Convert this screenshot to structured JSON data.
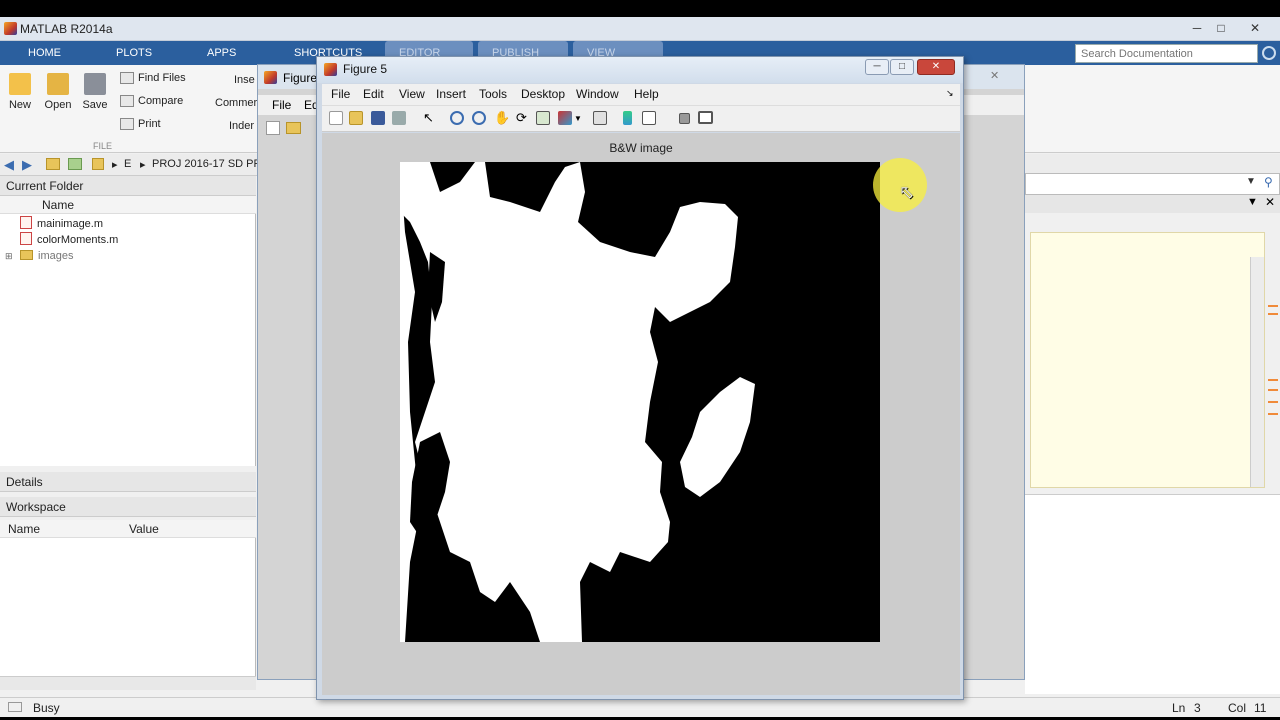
{
  "app": {
    "title": "MATLAB R2014a"
  },
  "tabs": [
    {
      "label": "HOME"
    },
    {
      "label": "PLOTS"
    },
    {
      "label": "APPS"
    },
    {
      "label": "SHORTCUTS"
    },
    {
      "label": "EDITOR"
    },
    {
      "label": "PUBLISH"
    },
    {
      "label": "VIEW"
    }
  ],
  "search": {
    "placeholder": "Search Documentation"
  },
  "ribbon": {
    "new": "New",
    "open": "Open",
    "save": "Save",
    "find_files": "Find Files",
    "compare": "Compare",
    "print": "Print",
    "insert": "Inse",
    "comment": "Commer",
    "indent": "Inder",
    "group_file": "FILE"
  },
  "address": {
    "crumb1": "E",
    "crumb2": "PROJ 2016-17 SD PRO"
  },
  "current_folder": {
    "title": "Current Folder",
    "col_name": "Name",
    "files": [
      "mainimage.m",
      "colorMoments.m"
    ],
    "folders": [
      "images"
    ]
  },
  "details": {
    "title": "Details"
  },
  "workspace": {
    "title": "Workspace",
    "col_name": "Name",
    "col_value": "Value"
  },
  "back_figure": {
    "title": "Figure",
    "menu_file": "File",
    "menu_edit": "Ed"
  },
  "figure5": {
    "title": "Figure 5",
    "menus": [
      "File",
      "Edit",
      "View",
      "Insert",
      "Tools",
      "Desktop",
      "Window",
      "Help"
    ],
    "axes_title": "B&W image"
  },
  "status": {
    "left": "Busy",
    "ln_label": "Ln",
    "ln": "3",
    "col_label": "Col",
    "col": "11"
  },
  "colors": {
    "tab_bar": "#2b5f9e",
    "editor_bg": "#fffde6",
    "cursor_highlight": "#faf03c"
  }
}
